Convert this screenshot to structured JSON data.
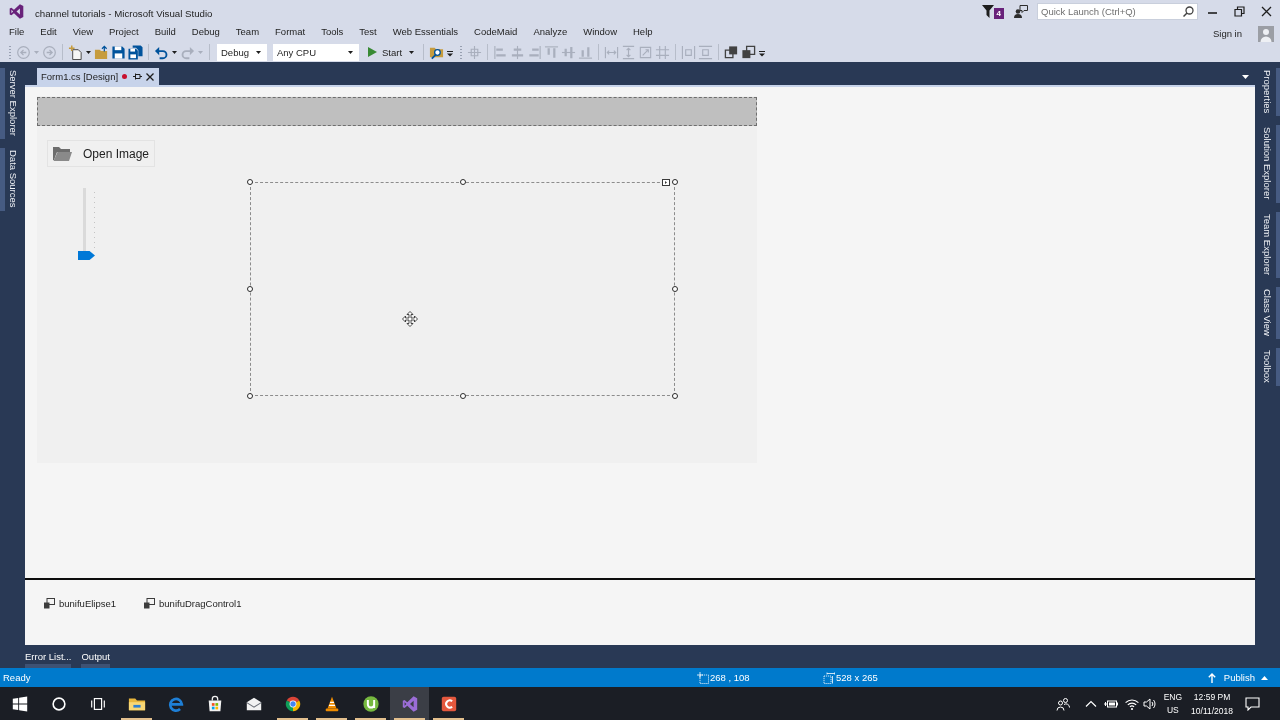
{
  "window": {
    "title": "channel tutorials - Microsoft Visual Studio",
    "notification_count": "4",
    "quick_launch": {
      "placeholder": "Quick Launch (Ctrl+Q)"
    }
  },
  "menu": [
    "File",
    "Edit",
    "View",
    "Project",
    "Build",
    "Debug",
    "Team",
    "Format",
    "Tools",
    "Test",
    "Web Essentials",
    "CodeMaid",
    "Analyze",
    "Window",
    "Help"
  ],
  "account": {
    "label": "Sign in"
  },
  "toolbars": [
    {
      "groups": [
        [
          {
            "kind": "back",
            "disabled": true
          },
          {
            "kind": "forward",
            "disabled": true
          }
        ],
        [
          {
            "kind": "new-project",
            "disabled": false
          },
          {
            "kind": "open",
            "disabled": false
          },
          {
            "kind": "save",
            "disabled": false
          },
          {
            "kind": "save-all",
            "disabled": false
          }
        ],
        [
          {
            "kind": "undo",
            "disabled": false
          },
          {
            "kind": "redo",
            "disabled": true
          }
        ],
        [
          {
            "kind": "dropdown",
            "value": "Debug"
          },
          {
            "kind": "dropdown",
            "value": "Any CPU"
          },
          {
            "kind": "start",
            "label": "Start"
          }
        ],
        [
          {
            "kind": "find",
            "disabled": false
          }
        ]
      ]
    },
    {
      "groups": [
        [
          {
            "kind": "snap-grid",
            "disabled": true
          }
        ],
        [
          {
            "kind": "align-left",
            "disabled": true
          },
          {
            "kind": "align-center",
            "disabled": true
          },
          {
            "kind": "align-right",
            "disabled": true
          },
          {
            "kind": "align-top",
            "disabled": true
          },
          {
            "kind": "align-middle",
            "disabled": true
          },
          {
            "kind": "align-bottom",
            "disabled": true
          }
        ],
        [
          {
            "kind": "same-width",
            "disabled": true
          },
          {
            "kind": "same-height",
            "disabled": true
          },
          {
            "kind": "same-size",
            "disabled": true
          },
          {
            "kind": "size-grid",
            "disabled": true
          }
        ],
        [
          {
            "kind": "center-horizontally",
            "disabled": true
          },
          {
            "kind": "center-vertically",
            "disabled": true
          }
        ],
        [
          {
            "kind": "bring-front",
            "disabled": false
          },
          {
            "kind": "send-back",
            "disabled": false
          }
        ]
      ]
    }
  ],
  "left_tool_tabs": [
    "Server Explorer",
    "Data Sources"
  ],
  "document_tabs": [
    {
      "label": "Form1.cs [Design]",
      "selected": true,
      "modified": true
    }
  ],
  "form": {
    "button": {
      "label": "Open Image"
    },
    "slider": {
      "level": 0
    },
    "picture_box": {
      "selected": true
    }
  },
  "components": [
    "bunifuElipse1",
    "bunifuDragControl1"
  ],
  "bottom_tabs": [
    "Error List...",
    "Output"
  ],
  "right_tool_tabs": [
    "Properties",
    "Solution Explorer",
    "Team Explorer",
    "Class View",
    "Toolbox"
  ],
  "status_bar": {
    "text": "Ready",
    "position": "268 , 108",
    "size": "528 x 265",
    "publish": "Publish"
  },
  "taskbar": {
    "apps": [
      {
        "kind": "explorer",
        "running": true,
        "selected": false
      },
      {
        "kind": "edge",
        "running": false,
        "selected": false
      },
      {
        "kind": "store",
        "running": false,
        "selected": false
      },
      {
        "kind": "mail",
        "running": false,
        "selected": false
      },
      {
        "kind": "chrome",
        "running": true,
        "selected": false
      },
      {
        "kind": "vlc",
        "running": true,
        "selected": false
      },
      {
        "kind": "utorrent",
        "running": true,
        "selected": false
      },
      {
        "kind": "visual-studio",
        "running": true,
        "selected": true
      },
      {
        "kind": "camtasia",
        "running": true,
        "selected": false
      }
    ],
    "language": {
      "input": "ENG",
      "region": "US"
    },
    "clock": {
      "time": "12:59 PM",
      "date": "10/11/2018"
    }
  }
}
